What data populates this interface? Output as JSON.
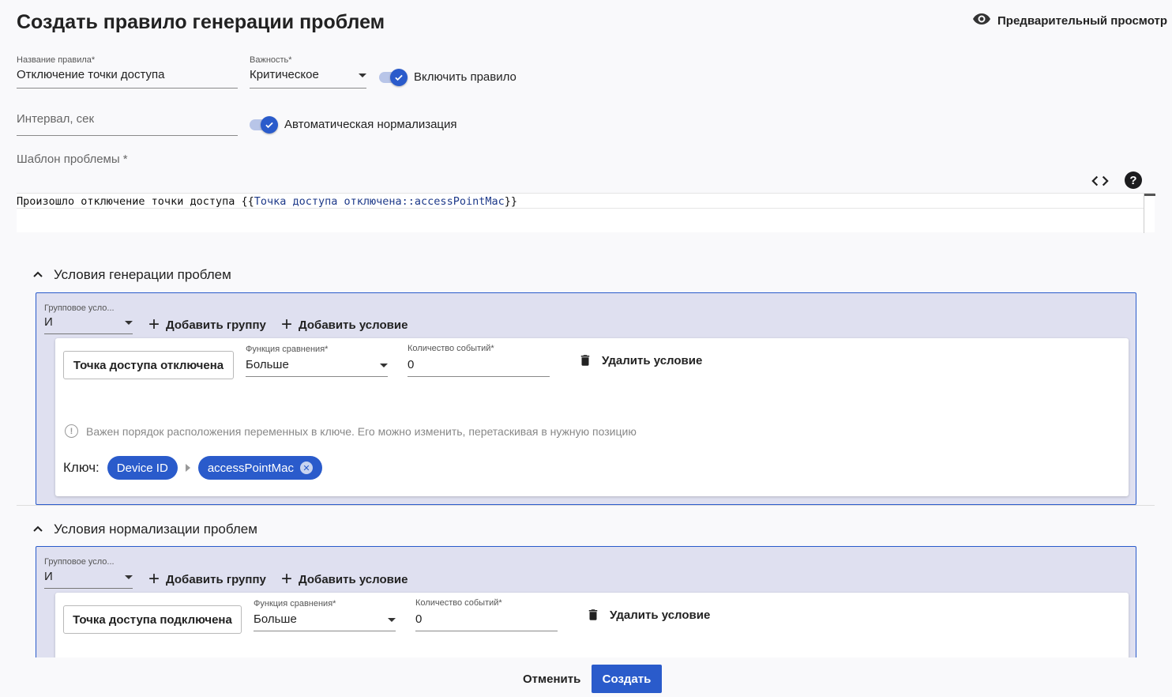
{
  "page": {
    "title": "Создать правило генерации проблем",
    "preview_label": "Предварительный просмотр"
  },
  "form": {
    "rule_name": {
      "label": "Название правила*",
      "value": "Отключение точки доступа"
    },
    "severity": {
      "label": "Важность*",
      "value": "Критическое"
    },
    "enable_rule": {
      "label": "Включить правило",
      "checked": true
    },
    "interval": {
      "placeholder": "Интервал, сек",
      "value": ""
    },
    "auto_normalize": {
      "label": "Автоматическая нормализация",
      "checked": true
    },
    "template": {
      "label": "Шаблон проблемы *",
      "prefix": "Произошло отключение точки доступа {{",
      "variable": "Точка доступа отключена::accessPointMac",
      "suffix": "}}"
    }
  },
  "generation": {
    "title": "Условия генерации проблем",
    "group_label": "Групповое усло...",
    "group_value": "И",
    "add_group": "Добавить группу",
    "add_condition": "Добавить условие",
    "condition": {
      "event": "Точка доступа отключена",
      "compare_label": "Функция сравнения*",
      "compare_value": "Больше",
      "count_label": "Количество событий*",
      "count_value": "0",
      "delete_label": "Удалить условие"
    },
    "hint": "Важен порядок расположения переменных в ключе. Его можно изменить, перетаскивая в нужную позицию",
    "key_label": "Ключ:",
    "key_chips": [
      "Device ID",
      "accessPointMac"
    ]
  },
  "normalization": {
    "title": "Условия нормализации проблем",
    "group_label": "Групповое усло...",
    "group_value": "И",
    "add_group": "Добавить группу",
    "add_condition": "Добавить условие",
    "condition": {
      "event": "Точка доступа подключена",
      "compare_label": "Функция сравнения*",
      "compare_value": "Больше",
      "count_label": "Количество событий*",
      "count_value": "0",
      "delete_label": "Удалить условие"
    }
  },
  "footer": {
    "cancel": "Отменить",
    "create": "Создать"
  },
  "colors": {
    "accent": "#2a5bcb",
    "group_bg": "#dfe0f0",
    "page_bg": "#f9f9fb"
  }
}
